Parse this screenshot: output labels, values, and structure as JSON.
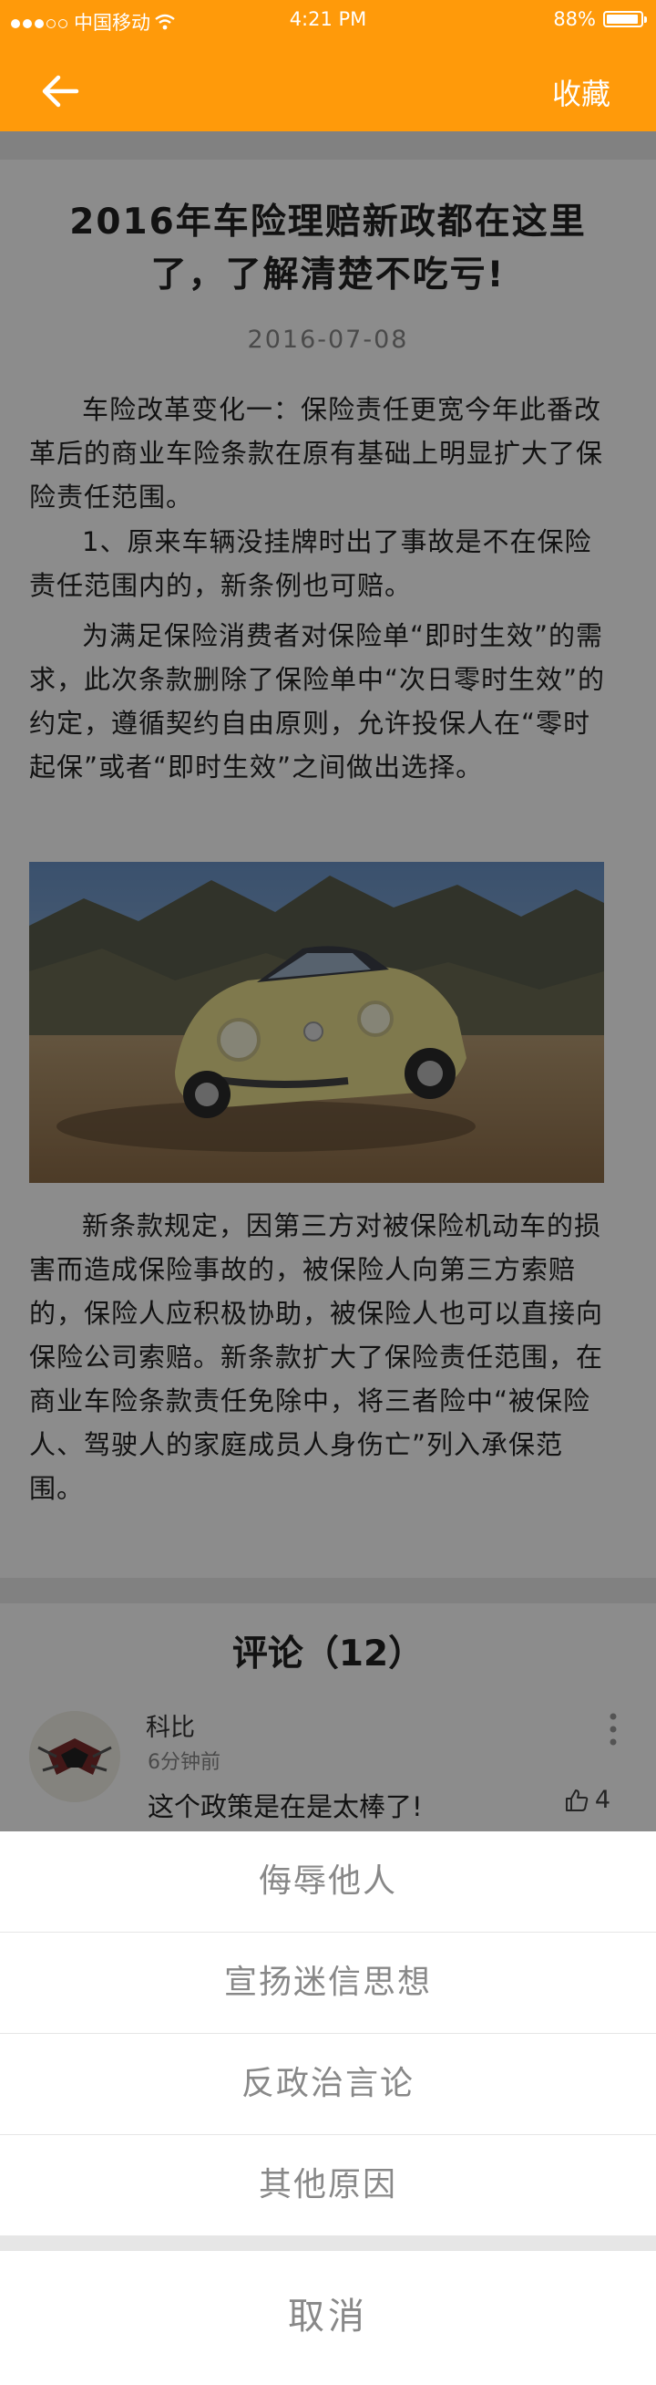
{
  "status_bar": {
    "carrier": "中国移动",
    "time": "4:21 PM",
    "battery": "88%",
    "battery_level": 0.88
  },
  "nav": {
    "favorite_label": "收藏"
  },
  "article": {
    "title": "2016年车险理赔新政都在这里了，了解清楚不吃亏!",
    "date": "2016-07-08",
    "paragraphs": [
      "车险改革变化一：保险责任更宽今年此番改革后的商业车险条款在原有基础上明显扩大了保险责任范围。",
      "1、原来车辆没挂牌时出了事故是不在保险责任范围内的，新条例也可赔。",
      "为满足保险消费者对保险单“即时生效”的需求，此次条款删除了保险单中“次日零时生效”的约定，遵循契约自由原则，允许投保人在“零时起保”或者“即时生效”之间做出选择。",
      "新条款规定，因第三方对被保险机动车的损害而造成保险事故的，被保险人向第三方索赔的，保险人应积极协助，被保险人也可以直接向保险公司索赔。新条款扩大了保险责任范围，在商业车险条款责任免除中，将三者险中“被保险人、驾驶人的家庭成员人身伤亡”列入承保范围。"
    ]
  },
  "comments": {
    "title": "评论（12）",
    "items": [
      {
        "user": "科比",
        "time": "6分钟前",
        "text": "这个政策是在是太棒了!",
        "likes": "4"
      }
    ]
  },
  "report_sheet": {
    "options": [
      "侮辱他人",
      "宣扬迷信思想",
      "反政治言论",
      "其他原因"
    ],
    "cancel_label": "取消"
  }
}
